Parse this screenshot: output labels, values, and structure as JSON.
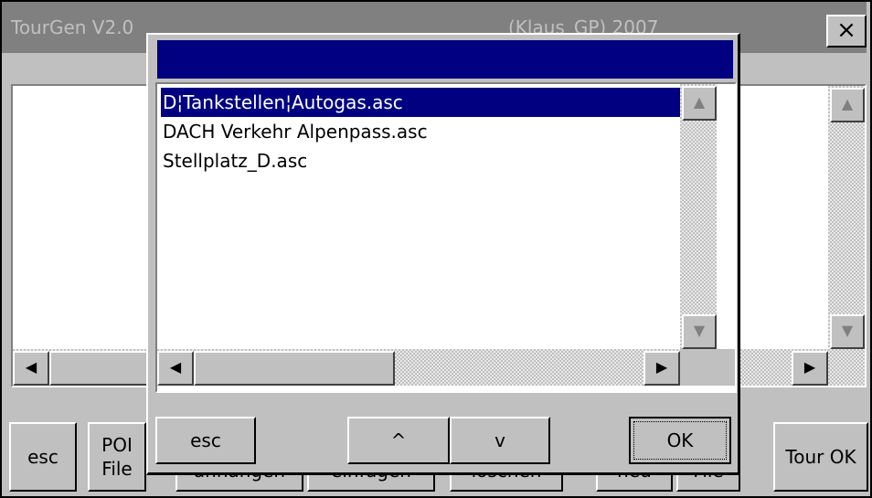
{
  "window": {
    "title_left": "TourGen V2.0",
    "title_right": "(Klaus_GP) 2007",
    "close_label": "×"
  },
  "main_buttons": {
    "esc": "esc",
    "poi_file_line1": "POI",
    "poi_file_line2": "File",
    "anhaengen": "anhängen",
    "einfuegen": "einfügen",
    "loeschen": "löschen",
    "neu": "neu",
    "file": "File",
    "tour_ok": "Tour OK"
  },
  "dialog": {
    "title": "",
    "files": [
      "D¦Tankstellen¦Autogas.asc",
      "DACH Verkehr Alpenpass.asc",
      "Stellplatz_D.asc"
    ],
    "selected_index": 0,
    "buttons": {
      "esc": "esc",
      "up": "^",
      "down": "v",
      "ok": "OK"
    }
  },
  "icons": {
    "scroll_up": "▲",
    "scroll_down": "▼",
    "scroll_left": "◀",
    "scroll_right": "▶"
  },
  "colors": {
    "titlebar_active": "#000080",
    "titlebar_inactive": "#808080",
    "face": "#c0c0c0"
  }
}
